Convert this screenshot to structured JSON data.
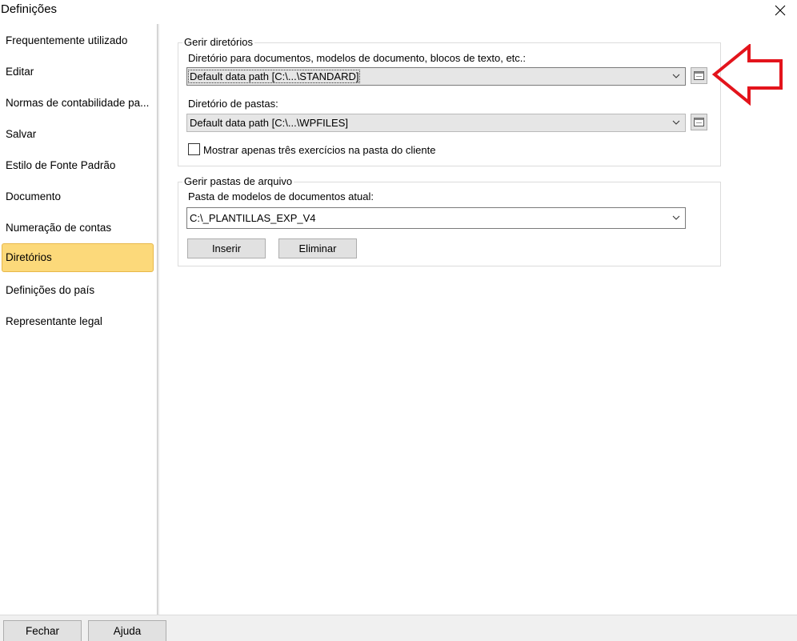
{
  "window": {
    "title": "Definições"
  },
  "sidebar": {
    "items": [
      {
        "label": "Frequentemente utilizado"
      },
      {
        "label": "Editar"
      },
      {
        "label": "Normas de contabilidade pa..."
      },
      {
        "label": "Salvar"
      },
      {
        "label": "Estilo de Fonte Padrão"
      },
      {
        "label": "Documento"
      },
      {
        "label": "Numeração de contas"
      },
      {
        "label": "Diretórios",
        "selected": true
      },
      {
        "label": "Definições do país"
      },
      {
        "label": "Representante legal"
      }
    ]
  },
  "manage_directories": {
    "legend": "Gerir diretórios",
    "documents_label": "Diretório para documentos, modelos de documento, blocos de texto, etc.:",
    "documents_value": "Default data path [C:\\...\\STANDARD]",
    "folders_label": "Diretório de pastas:",
    "folders_value": "Default data path [C:\\...\\WPFILES]",
    "checkbox_label": "Mostrar apenas três exercícios na pasta do cliente",
    "checkbox_checked": false
  },
  "archive_folders": {
    "legend": "Gerir pastas de arquivo",
    "current_label": "Pasta de modelos de documentos atual:",
    "current_value": "C:\\_PLANTILLAS_EXP_V4",
    "insert_label": "Inserir",
    "delete_label": "Eliminar"
  },
  "footer": {
    "close_label": "Fechar",
    "help_label": "Ajuda"
  },
  "colors": {
    "selected_bg": "#fcd97a",
    "annotation_arrow": "#e3141c"
  }
}
